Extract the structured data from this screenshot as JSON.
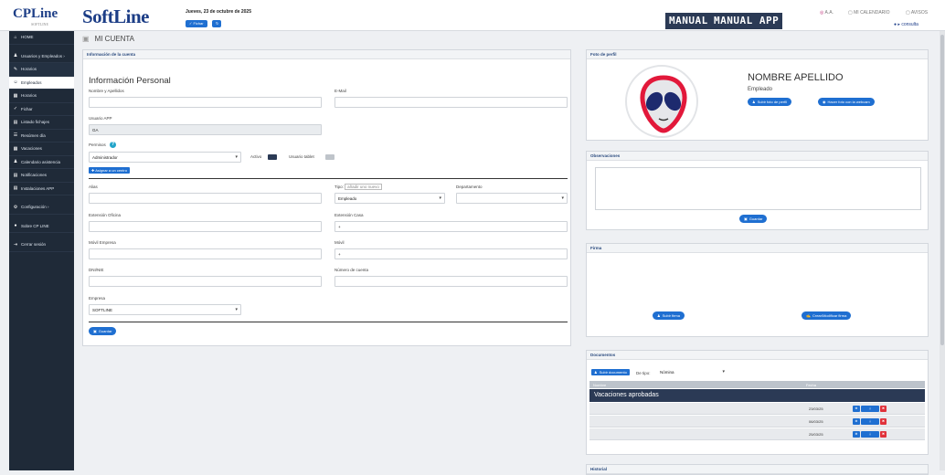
{
  "header": {
    "cp_logo": "CPLine",
    "cp_sub": "SOFTLINE",
    "soft_logo": "SoftLine",
    "date": "Jueves, 23 de octubre de 2025",
    "btn_fichar": "✓ Fichar",
    "manual": "MANUAL",
    "manual_app": "MANUAL APP",
    "user_initials": "A.A.",
    "calendar_link": "MI CALENDARIO",
    "notices_link": "AVISOS",
    "user_link": "consulta"
  },
  "sidebar": {
    "items": [
      {
        "icon": "⌂",
        "label": "HOME"
      },
      {
        "icon": "♟",
        "label": "Usuarios y Empleados ›"
      },
      {
        "icon": "✎",
        "label": "Horarios"
      },
      {
        "icon": "☺",
        "label": "Empleados"
      },
      {
        "icon": "▦",
        "label": "Horarios"
      },
      {
        "icon": "✓",
        "label": "Fichar"
      },
      {
        "icon": "▤",
        "label": "Listado fichajes"
      },
      {
        "icon": "☰",
        "label": "Resúmen día"
      },
      {
        "icon": "▦",
        "label": "Vacaciones"
      },
      {
        "icon": "♟",
        "label": "Calendario asistencia"
      },
      {
        "icon": "▤",
        "label": "Notificaciones"
      },
      {
        "icon": "▤",
        "label": "Instalaciones APP"
      },
      {
        "icon": "⚙",
        "label": "Configuración ›"
      },
      {
        "icon": "●",
        "label": "Sobre CP LINE"
      },
      {
        "icon": "⇥",
        "label": "Cerrar sesión"
      }
    ]
  },
  "breadcrumb": "MI CUENTA",
  "info": {
    "panel_title": "Información de la cuenta",
    "section_title": "Información Personal",
    "name_label": "Nombre y Apellidos",
    "email_label": "E-Mail",
    "user_app_label": "Usuario APP",
    "user_app_value": "GA",
    "permisos_label": "Permisos",
    "permisos_value": "Administrador",
    "activo_label": "Activo",
    "tablet_label": "Usuario tablet",
    "asignar_btn": "✚ Asignar a un centro",
    "alias_label": "Alias",
    "tipo_label": "Tipo",
    "tipo_hint": "añadir uno nuevo",
    "tipo_value": "Empleado",
    "depto_label": "Departamento",
    "ext_oficina_label": "Extensión Oficina",
    "ext_casa_label": "Extensión Casa",
    "ext_casa_value": "+",
    "movil_empresa_label": "Móvil Empresa",
    "movil_label": "Móvil",
    "movil_value": "+",
    "dni_label": "DNI/NIE",
    "cuenta_label": "Número de cuenta",
    "empresa_label": "Empresa",
    "empresa_value": "SOFTLINE",
    "save_btn": "Guardar"
  },
  "profile": {
    "panel_title": "Foto de perfil",
    "name": "NOMBRE APELLIDO",
    "role": "Empleado",
    "upload_btn": "Subir foto de perfil",
    "webcam_btn": "Hacer foto con la webcam"
  },
  "observaciones": {
    "panel_title": "Observaciones",
    "save_btn": "Guardar"
  },
  "firma": {
    "panel_title": "Firma",
    "upload_btn": "Subir firma",
    "create_btn": "Crear/Modificar firma"
  },
  "documentos": {
    "panel_title": "Documentos",
    "upload_btn": "Subir documento",
    "tipo_label": "De tipo:",
    "tipo_value": "Nómina",
    "col_name": "Nombre",
    "col_date": "Fecha",
    "group": "Vacaciones aprobadas",
    "rows": [
      {
        "date": "23/03/25"
      },
      {
        "date": "06/03/25"
      },
      {
        "date": "25/03/25"
      }
    ],
    "next_panel_title": "Historial"
  },
  "colors": {
    "accent": "#1f6fd1",
    "sidebar": "#1f2a38",
    "danger": "#e0323b"
  }
}
